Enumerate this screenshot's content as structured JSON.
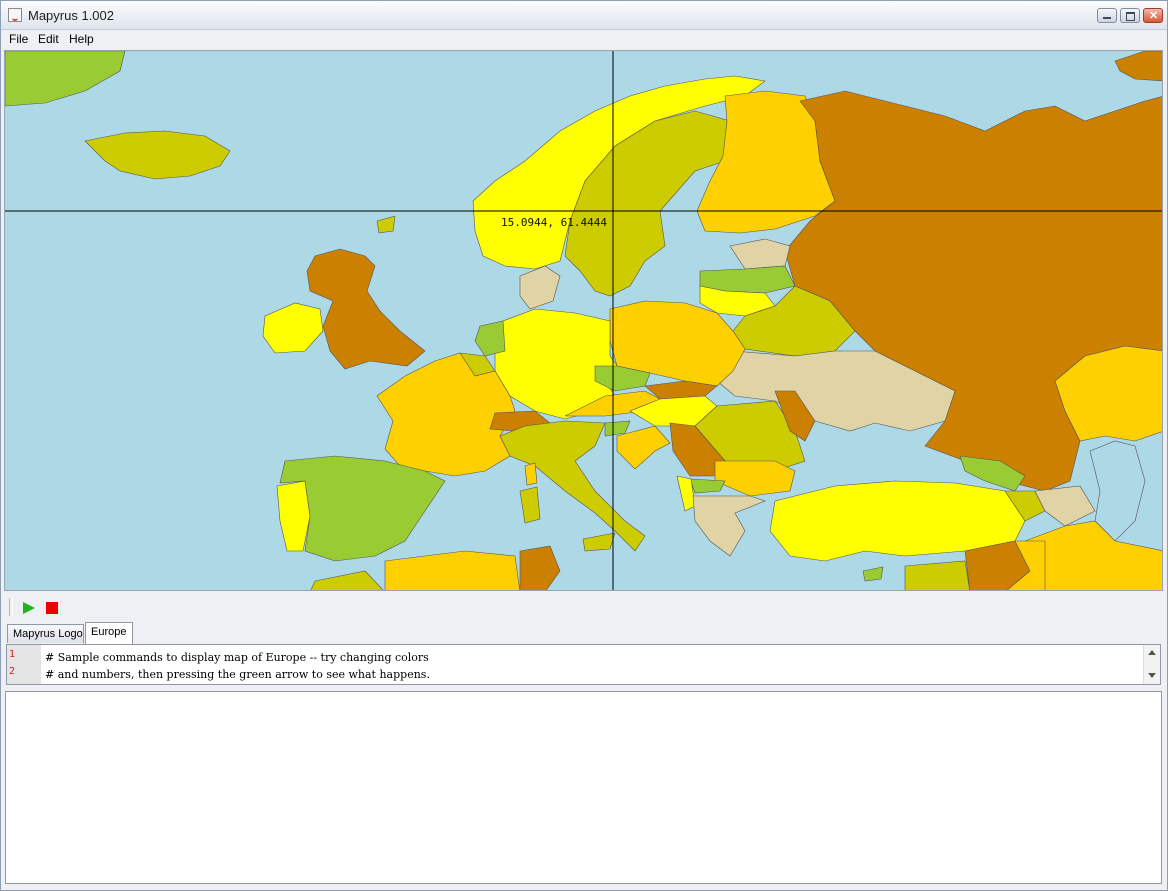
{
  "window": {
    "title": "Mapyrus 1.002"
  },
  "menu": {
    "items": [
      "File",
      "Edit",
      "Help"
    ]
  },
  "map": {
    "cursor_readout": "15.0944, 61.4444",
    "colors": {
      "sea": "#add8e6",
      "russia": "#cc8000",
      "yellow": "#ffff00",
      "gold": "#ffd000",
      "olive": "#cccc00",
      "green": "#99cc33",
      "beige": "#e0d4a6",
      "brown": "#cc8000",
      "crosshair": "#000000"
    }
  },
  "toolbar": {
    "run_icon": "play-icon",
    "stop_icon": "stop-icon"
  },
  "tabs": [
    {
      "label": "Mapyrus Logo",
      "selected": false
    },
    {
      "label": "Europe",
      "selected": true
    }
  ],
  "editor": {
    "lines": [
      {
        "num": "1",
        "text": "# Sample commands to display map of Europe -- try changing colors"
      },
      {
        "num": "2",
        "text": "# and numbers, then pressing the green arrow to see what happens."
      }
    ]
  },
  "output": {
    "text": ""
  }
}
